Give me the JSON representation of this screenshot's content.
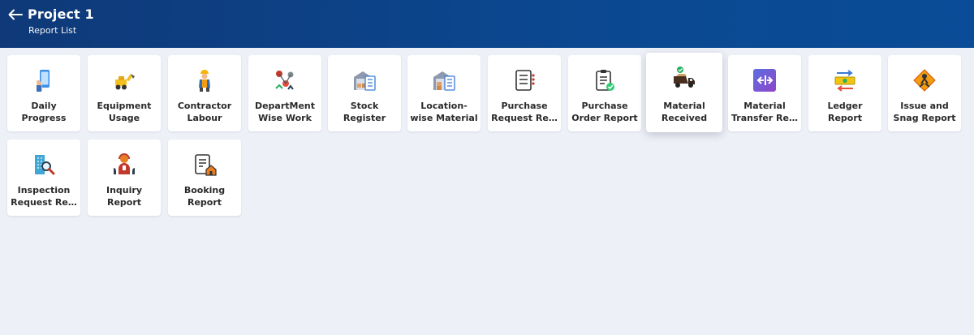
{
  "header": {
    "title": "Project 1",
    "subtitle": "Report List",
    "back_icon": "arrow-left-icon"
  },
  "reports": [
    {
      "label": "Daily\nProgress",
      "icon": "mobile-hand-icon"
    },
    {
      "label": "Equipment\nUsage",
      "icon": "excavator-icon"
    },
    {
      "label": "Contractor\nLabour",
      "icon": "worker-icon"
    },
    {
      "label": "DepartMent\nWise Work",
      "icon": "network-people-icon"
    },
    {
      "label": "Stock\nRegister",
      "icon": "warehouse-list-icon"
    },
    {
      "label": "Location-\nwise Material",
      "icon": "warehouse-boxes-icon"
    },
    {
      "label": "Purchase\nRequest Re…",
      "icon": "checklist-icon"
    },
    {
      "label": "Purchase\nOrder Report",
      "icon": "clipboard-check-icon"
    },
    {
      "label": "Material\nReceived",
      "icon": "dump-truck-check-icon",
      "active": true
    },
    {
      "label": "Material\nTransfer Re…",
      "icon": "transfer-arrows-icon"
    },
    {
      "label": "Ledger\nReport",
      "icon": "money-exchange-icon"
    },
    {
      "label": "Issue and\nSnag Report",
      "icon": "warning-tools-icon"
    },
    {
      "label": "Inspection\nRequest Re…",
      "icon": "building-magnifier-icon"
    },
    {
      "label": "Inquiry\nReport",
      "icon": "support-agent-icon"
    },
    {
      "label": "Booking\nReport",
      "icon": "document-house-icon"
    }
  ]
}
